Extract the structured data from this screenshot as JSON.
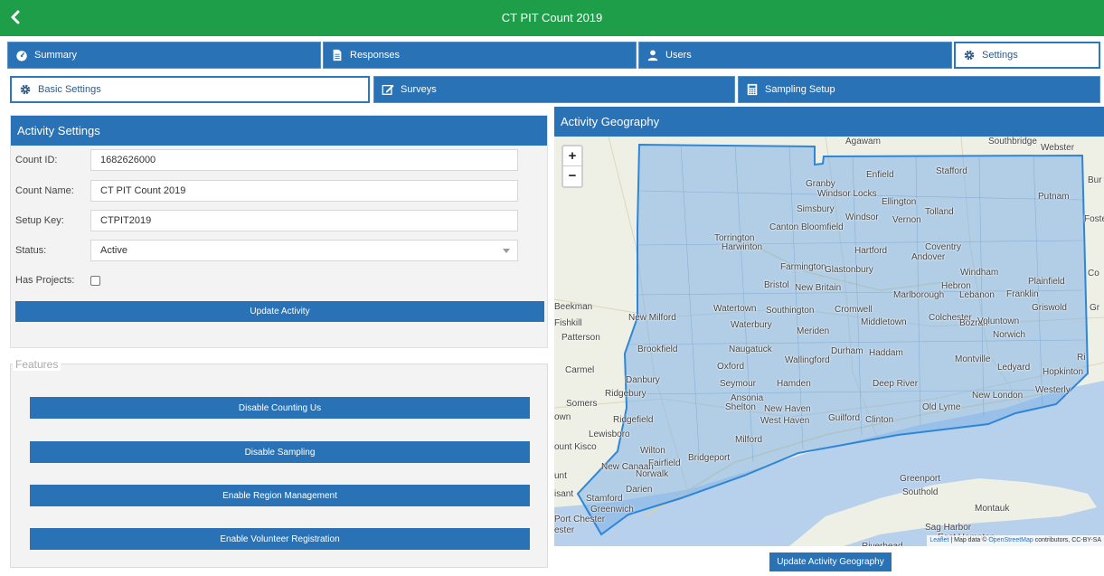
{
  "header": {
    "title": "CT PIT Count 2019",
    "back_icon": "chevron-left-icon"
  },
  "main_tabs": [
    {
      "label": "Summary",
      "icon": "dashboard-icon",
      "active": false
    },
    {
      "label": "Responses",
      "icon": "document-icon",
      "active": false
    },
    {
      "label": "Users",
      "icon": "user-icon",
      "active": false
    },
    {
      "label": "Settings",
      "icon": "gear-icon",
      "active": true
    }
  ],
  "sub_tabs": [
    {
      "label": "Basic Settings",
      "icon": "gear-icon",
      "active": true
    },
    {
      "label": "Surveys",
      "icon": "edit-icon",
      "active": false
    },
    {
      "label": "Sampling Setup",
      "icon": "calculator-icon",
      "active": false
    }
  ],
  "activity_settings": {
    "title": "Activity Settings",
    "count_id": {
      "label": "Count ID:",
      "value": "1682626000"
    },
    "count_name": {
      "label": "Count Name:",
      "value": "CT PIT Count 2019"
    },
    "setup_key": {
      "label": "Setup Key:",
      "value": "CTPIT2019"
    },
    "status": {
      "label": "Status:",
      "value": "Active"
    },
    "has_projects": {
      "label": "Has Projects:",
      "checked": false
    },
    "update_button": "Update Activity"
  },
  "features": {
    "legend": "Features",
    "buttons": [
      "Disable Counting Us",
      "Disable Sampling",
      "Enable Region Management",
      "Enable Volunteer Registration"
    ]
  },
  "geography": {
    "title": "Activity Geography",
    "zoom_in": "+",
    "zoom_out": "−",
    "places": [
      "Agawam",
      "Southbridge",
      "Webster",
      "Enfield",
      "Stafford",
      "Bur",
      "Granby",
      "Windsor Locks",
      "Ellington",
      "Putnam",
      "Simsbury",
      "Tolland",
      "Windsor",
      "Vernon",
      "Foste",
      "Canton",
      "Bloomfield",
      "Torrington",
      "Harwinton",
      "Hartford",
      "Coventry",
      "Andover",
      "Farmington",
      "Glastonbury",
      "Windham",
      "Co",
      "Plainfield",
      "Bristol",
      "New Britain",
      "Hebron",
      "Marlborough",
      "Lebanon",
      "Franklin",
      "Griswold",
      "Gr",
      "Beekman",
      "New Milford",
      "Watertown",
      "Southington",
      "Cromwell",
      "Middletown",
      "Colchester",
      "Bozrah",
      "Voluntown",
      "Fishkill",
      "Waterbury",
      "Meriden",
      "Norwich",
      "Patterson",
      "Naugatuck",
      "Brookfield",
      "Durham",
      "Haddam",
      "Montville",
      "Ri",
      "Wallingford",
      "Oxford",
      "Ledyard",
      "Hopkinton",
      "Carmel",
      "Danbury",
      "Seymour",
      "Hamden",
      "Deep River",
      "Ridgebury",
      "Ansonia",
      "New London",
      "Westerly",
      "Somers",
      "Shelton",
      "New Haven",
      "Old Lyme",
      "own",
      "Ridgefield",
      "West Haven",
      "Guilford",
      "Clinton",
      "Lewisboro",
      "Milford",
      "ount Kisco",
      "Wilton",
      "Bridgeport",
      "New Canaan",
      "Fairfield",
      "Norwalk",
      "unt",
      "Darien",
      "isant",
      "Stamford",
      "Greenport",
      "Greenwich",
      "Southold",
      "Port Chester",
      "Montauk",
      "ester",
      "Sag Harbor",
      "East Hampton",
      "Riverhead"
    ],
    "attribution_leaflet": "Leaflet",
    "attribution_text": " | Map data © ",
    "attribution_osm": "OpenStreetMap",
    "attribution_rest": " contributors, CC-BY-SA",
    "update_button": "Update Activity Geography"
  },
  "colors": {
    "header_green": "#1f9e4a",
    "primary_blue": "#2872b5",
    "region_fill": "#7fb2e5",
    "water": "#b7d0ec"
  }
}
